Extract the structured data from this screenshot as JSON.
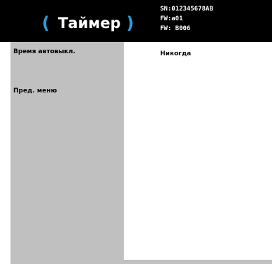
{
  "header": {
    "title": "Таймер",
    "paren_left": "(",
    "paren_right": ")",
    "info_lines": [
      "SN:012345678AB",
      "FW:a01",
      "FW: B006"
    ]
  },
  "sidebar": {
    "items": [
      {
        "label": "Время автовыкл."
      },
      {
        "label": "Пред. меню"
      }
    ]
  },
  "content": {
    "values": [
      "Никогда"
    ]
  },
  "colors": {
    "header_bg": "#000000",
    "accent": "#2f9ad8",
    "sidebar_bg": "#c0c0c0",
    "content_bg": "#ffffff"
  }
}
